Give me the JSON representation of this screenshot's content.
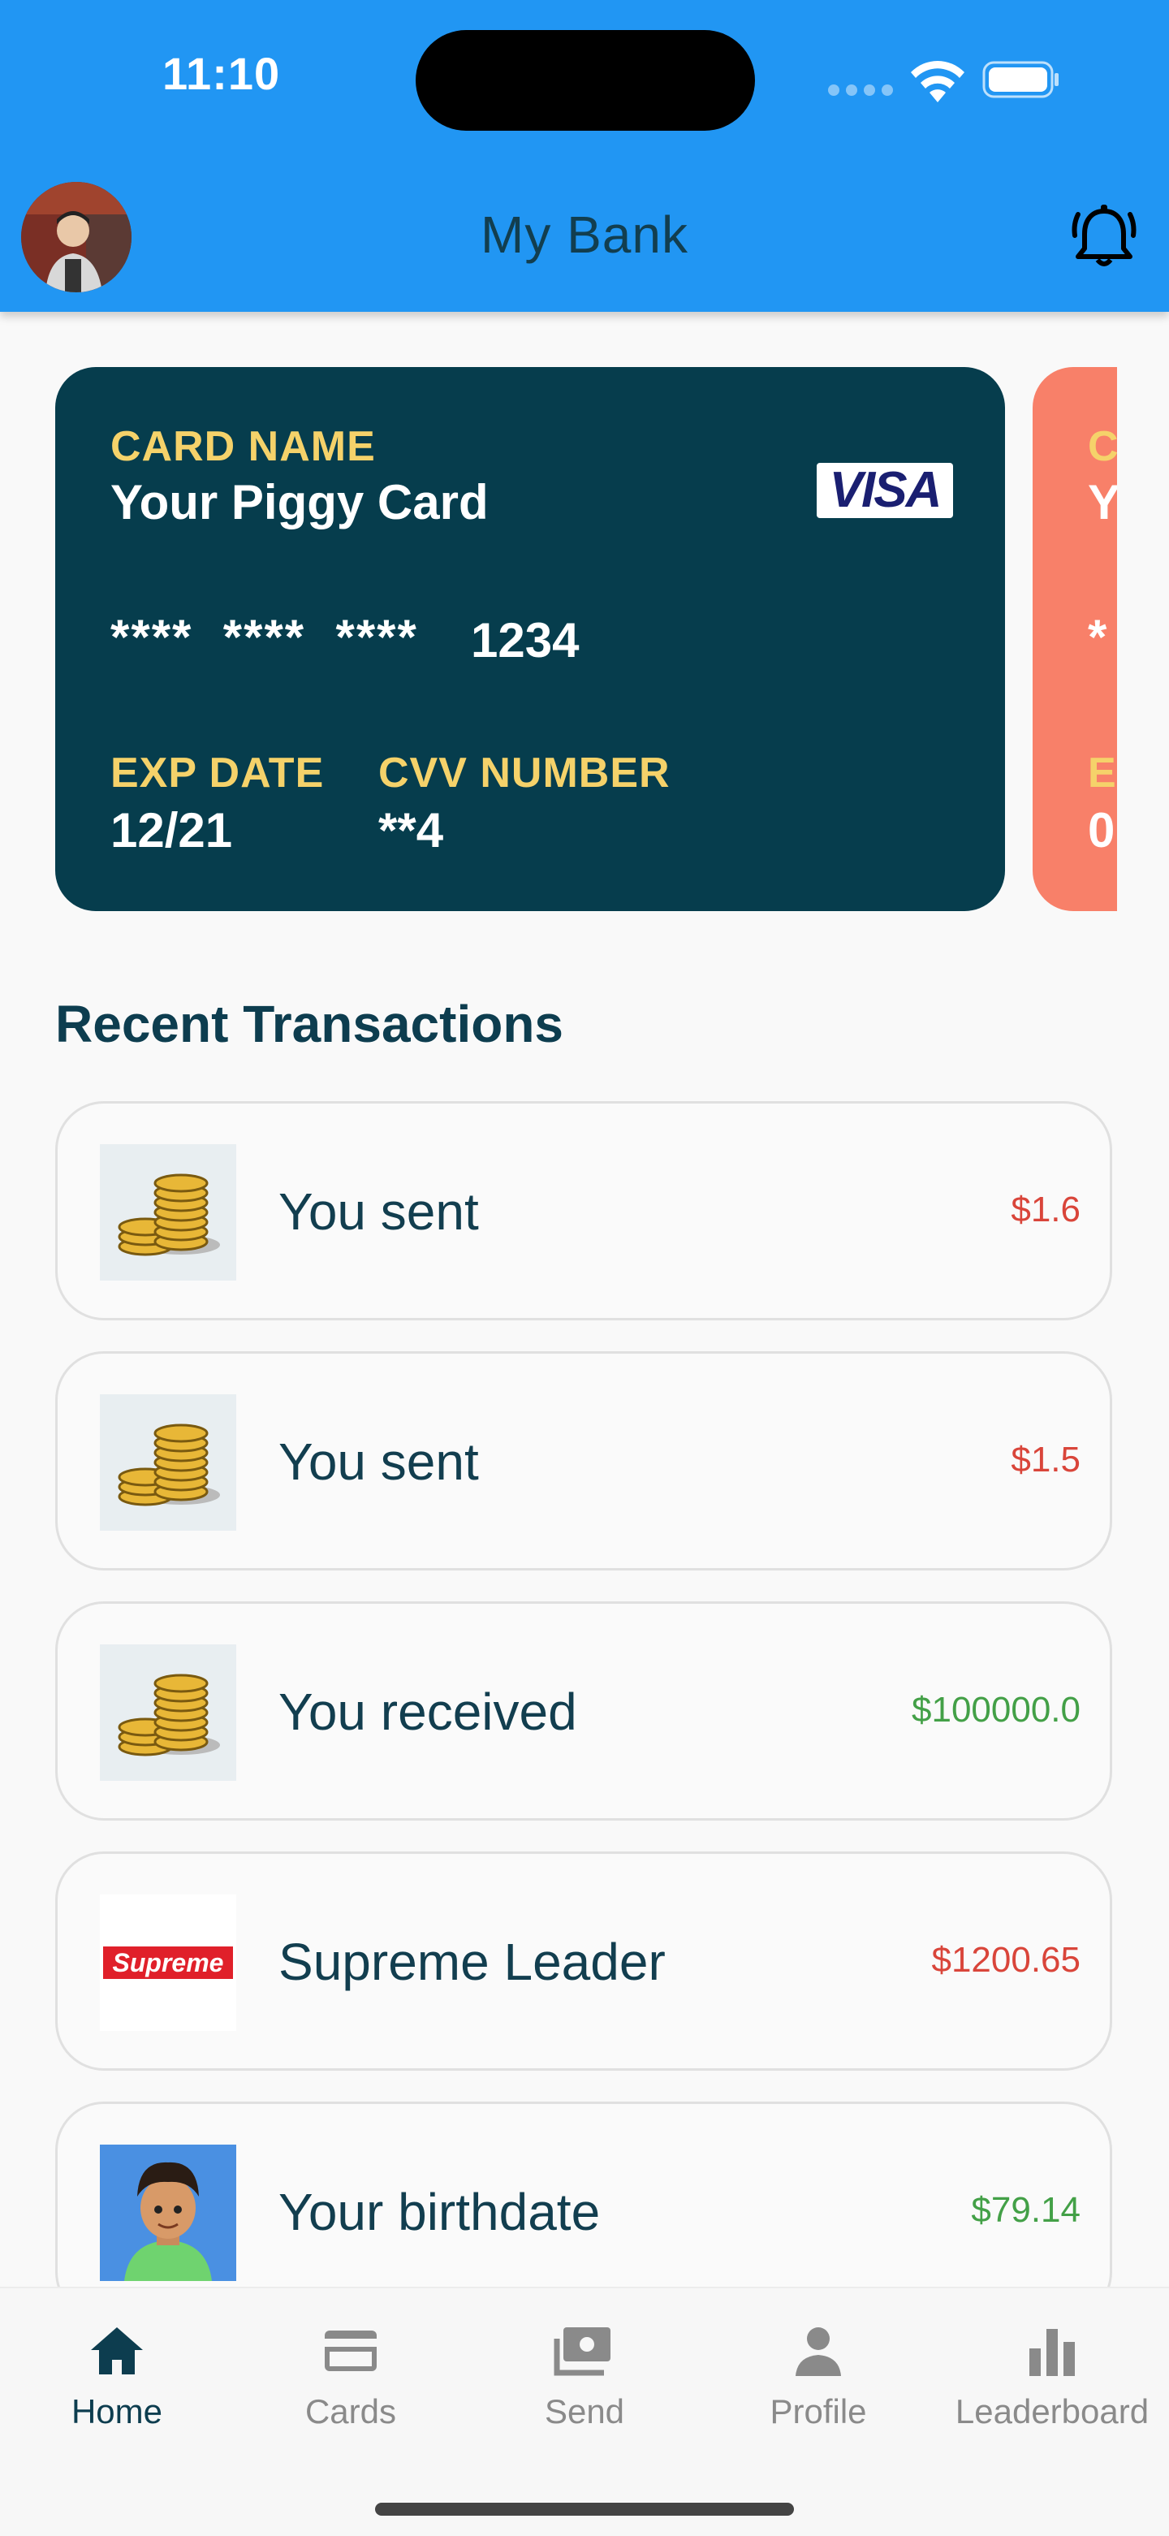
{
  "status_bar": {
    "time": "11:10"
  },
  "header": {
    "title": "My Bank"
  },
  "cards": [
    {
      "name_label": "CARD NAME",
      "name": "Your Piggy Card",
      "brand": "VISA",
      "number_masked": "****  ****  ****",
      "number_last": "1234",
      "exp_label": "EXP DATE",
      "exp": "12/21",
      "cvv_label": "CVV NUMBER",
      "cvv": "**4",
      "color": "#063d4d"
    },
    {
      "name_label": "C",
      "name": "Y",
      "number_masked": "*",
      "exp_label": "E",
      "exp": "0",
      "color": "#f88069"
    }
  ],
  "recent": {
    "title": "Recent Transactions",
    "items": [
      {
        "label": "You sent",
        "amount": "$1.6",
        "type": "debit",
        "thumb": "coins-icon"
      },
      {
        "label": "You sent",
        "amount": "$1.5",
        "type": "debit",
        "thumb": "coins-icon"
      },
      {
        "label": "You received",
        "amount": "$100000.0",
        "type": "credit",
        "thumb": "coins-icon"
      },
      {
        "label": "Supreme Leader",
        "amount": "$1200.65",
        "type": "debit",
        "thumb": "supreme-logo",
        "thumb_text": "Supreme"
      },
      {
        "label": "Your birthdate",
        "amount": "$79.14",
        "type": "credit",
        "thumb": "avatar-cartoon"
      }
    ]
  },
  "nav": [
    {
      "label": "Home",
      "icon": "home-icon",
      "active": true
    },
    {
      "label": "Cards",
      "icon": "credit-card-icon",
      "active": false
    },
    {
      "label": "Send",
      "icon": "money-send-icon",
      "active": false
    },
    {
      "label": "Profile",
      "icon": "person-icon",
      "active": false
    },
    {
      "label": "Leaderboard",
      "icon": "bar-chart-icon",
      "active": false
    }
  ],
  "colors": {
    "header": "#2196f3",
    "primary": "#063d4d",
    "accent_label": "#f5d26a",
    "debit": "#d9453a",
    "credit": "#43a047"
  }
}
